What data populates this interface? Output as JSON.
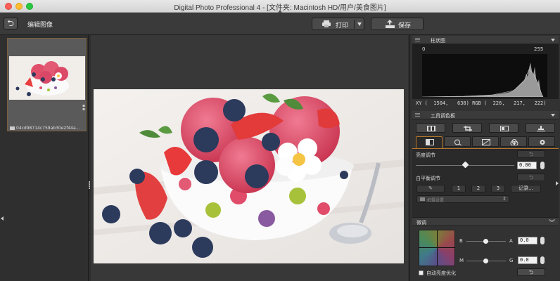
{
  "window": {
    "title": "Digital Photo Professional 4 - [文件夹: Macintosh HD/用户/美食图片]"
  },
  "toolbar": {
    "page_title": "编辑图像",
    "print_label": "打印",
    "save_label": "保存"
  },
  "thumbnail": {
    "filename": "04cd98714c759ab30e2f44a..."
  },
  "histogram": {
    "title": "柱状图",
    "min_label": "0",
    "max_label": "255",
    "readout": "XY (  1504,   638) RGB (  226,   217,   222)"
  },
  "tool_palette": {
    "title": "工具调色板",
    "brightness_label": "亮度调节",
    "brightness_value": "0.00",
    "brightness_level": 0.5,
    "white_balance_label": "白平衡调节",
    "wb_preset_1": "1",
    "wb_preset_2": "2",
    "wb_preset_3": "3",
    "wb_record": "记录...",
    "shoot_setting": "拍摄设置",
    "fine_tune_label": "微调",
    "b_label": "B",
    "a_label": "A",
    "a_value": "0.0",
    "m_label": "M",
    "g_label": "G",
    "g_value": "0.0",
    "auto_brightness_label": "自动亮度优化"
  },
  "icons": {
    "back": "back-arrow-icon",
    "print": "printer-icon",
    "save": "save-tray-icon",
    "undo": "undo-icon",
    "eyedropper": "eyedropper-icon"
  }
}
